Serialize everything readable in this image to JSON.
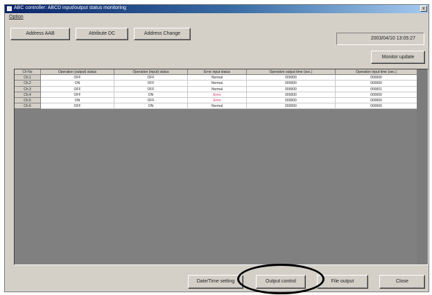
{
  "window": {
    "title": "ABC controller: ABCD input/output status monitoring",
    "close_glyph": "x"
  },
  "menu": {
    "option": "Option"
  },
  "tabs": [
    {
      "label": "Address AAB"
    },
    {
      "label": "Attribute DC"
    },
    {
      "label": "Address Change"
    }
  ],
  "datetime": "2003/04/10 13:05:27",
  "buttons": {
    "monitor_update": "Monitor update",
    "date_time_setting": "Date/Time setting",
    "output_control": "Output control",
    "file_output": "File output",
    "close": "Close"
  },
  "table": {
    "columns": [
      "Ch No",
      "Operation (output) status",
      "Operation (input) status",
      "Error input status",
      "Operation output time (sec.)",
      "Operation input time (sec.)"
    ],
    "rows": [
      {
        "ch": "Ch.1",
        "out": "OFF",
        "in": "OFF",
        "err": "Normal",
        "out_time": "000000",
        "in_time": "000000",
        "is_error": false
      },
      {
        "ch": "Ch.2",
        "out": "ON",
        "in": "OFF",
        "err": "Normal",
        "out_time": "000000",
        "in_time": "000000",
        "is_error": false
      },
      {
        "ch": "Ch.3",
        "out": "OFF",
        "in": "OFF",
        "err": "Normal",
        "out_time": "000000",
        "in_time": "000001",
        "is_error": false
      },
      {
        "ch": "Ch.4",
        "out": "OFF",
        "in": "ON",
        "err": "Error",
        "out_time": "000000",
        "in_time": "000000",
        "is_error": true
      },
      {
        "ch": "Ch.5",
        "out": "ON",
        "in": "OFF",
        "err": "Error",
        "out_time": "000000",
        "in_time": "000000",
        "is_error": true
      },
      {
        "ch": "Ch.6",
        "out": "OFF",
        "in": "ON",
        "err": "Normal",
        "out_time": "000000",
        "in_time": "000000",
        "is_error": false
      }
    ]
  },
  "colors": {
    "error_text": "#e03060",
    "grid_empty": "#808080",
    "titlebar": "#0a246a"
  },
  "icons": {
    "app": "app-icon"
  }
}
